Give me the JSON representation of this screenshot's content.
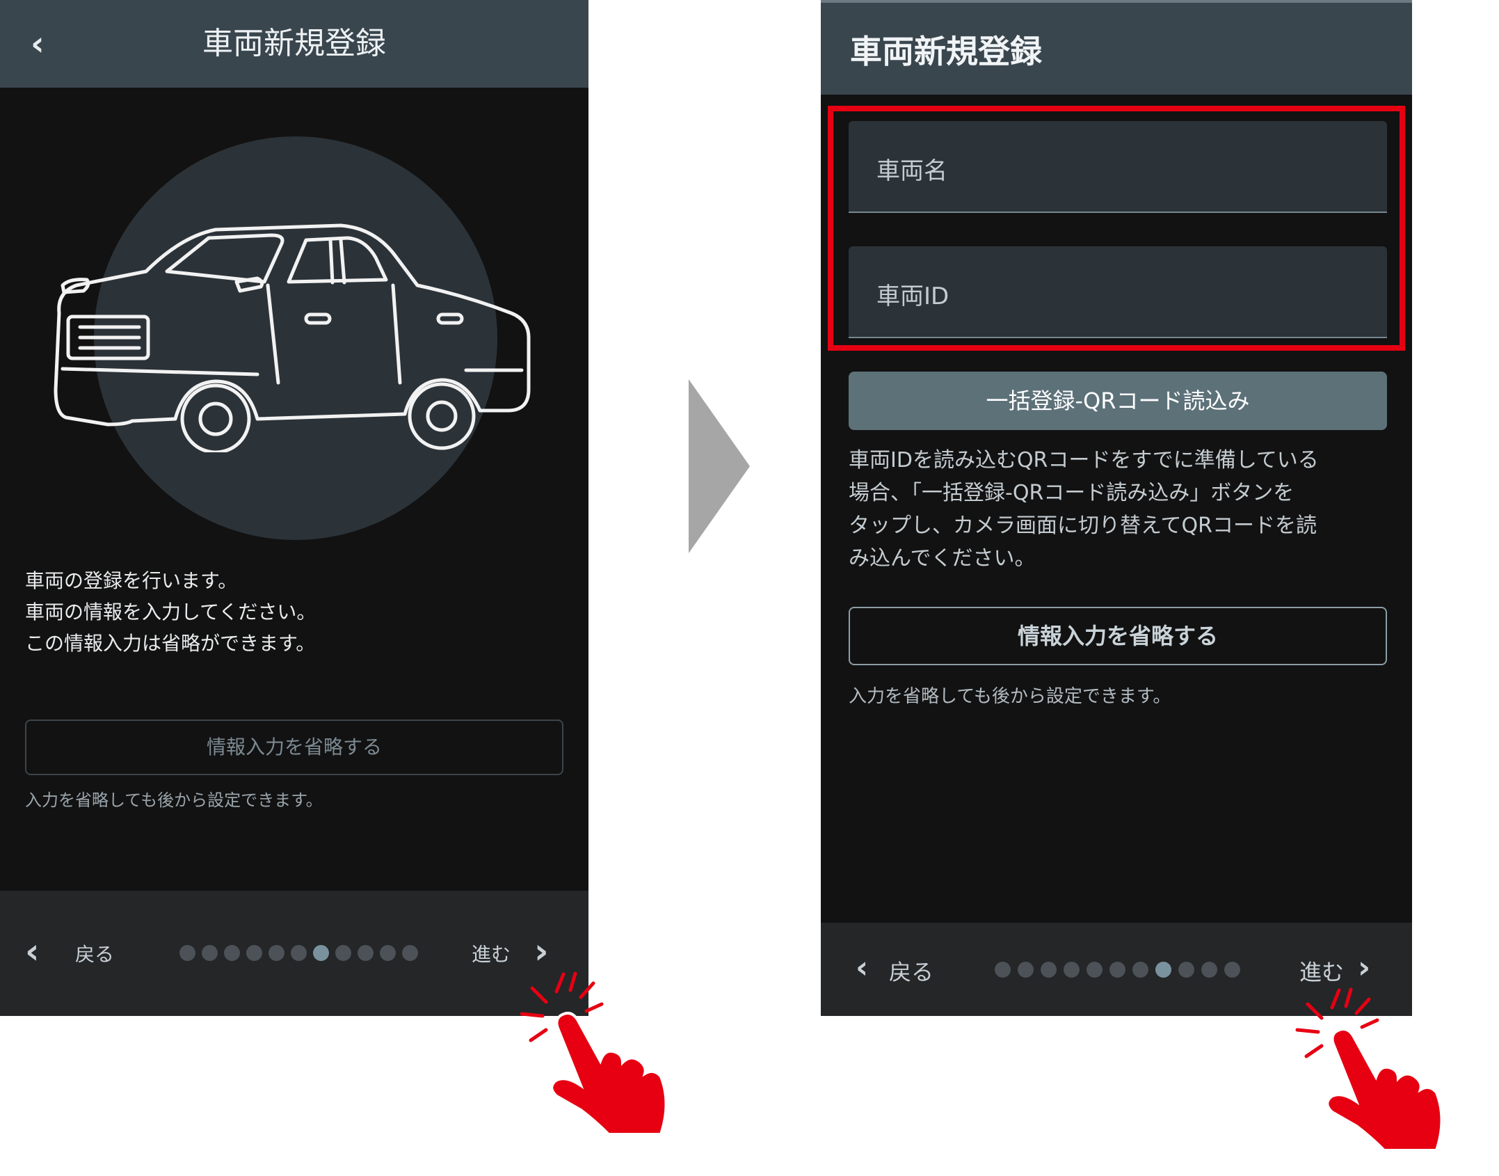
{
  "left_screen": {
    "title": "車両新規登録",
    "description_lines": [
      "車両の登録を行います。",
      "車両の情報を入力してください。",
      "この情報入力は省略ができます。"
    ],
    "skip_button": "情報入力を省略する",
    "skip_note": "入力を省略しても後から設定できます。",
    "footer": {
      "back": "戻る",
      "next": "進む",
      "dot_count": 11,
      "active_dot": 6
    }
  },
  "right_screen": {
    "title": "車両新規登録",
    "fields": {
      "vehicle_name_placeholder": "車両名",
      "vehicle_id_placeholder": "車両ID"
    },
    "qr_button": "一括登録-QRコード読込み",
    "qr_description_lines": [
      "車両IDを読み込むQRコードをすでに準備している",
      "場合、「一括登録-QRコード読み込み」ボタンを",
      "タップし、カメラ画面に切り替えてQRコードを読",
      "み込んでください。"
    ],
    "skip_button": "情報入力を省略する",
    "skip_note": "入力を省略しても後から設定できます。",
    "footer": {
      "back": "戻る",
      "next": "進む",
      "dot_count": 11,
      "active_dot": 7
    }
  },
  "icons": {
    "back": "chevron-left-icon",
    "next": "chevron-right-icon",
    "transition": "triangle-arrow-icon",
    "tap": "tapping-hand-icon",
    "illustration": "car-icon"
  },
  "colors": {
    "highlight": "#e50012",
    "hand": "#e60012",
    "header": "#3a464e",
    "screen_bg": "#121212"
  }
}
